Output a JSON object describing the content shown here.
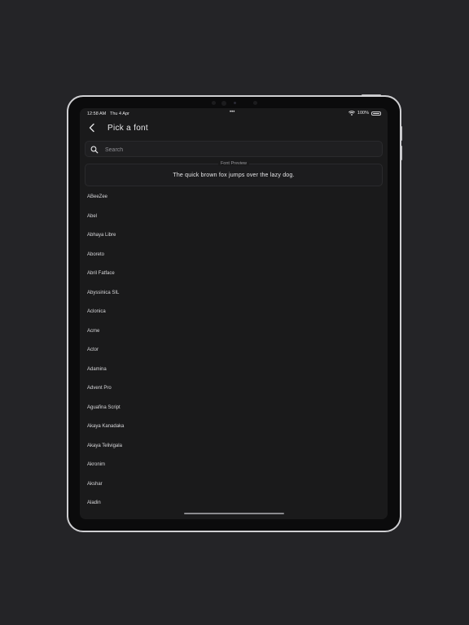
{
  "status_bar": {
    "time": "12:58 AM",
    "date": "Thu 4 Apr",
    "center_dots": "•••",
    "battery": "100%"
  },
  "nav": {
    "back_icon": "chevron-left-icon",
    "title": "Pick a font"
  },
  "search": {
    "icon": "search-icon",
    "placeholder": "Search",
    "value": ""
  },
  "preview": {
    "label": "Font Preview",
    "text": "The quick brown fox jumps over the lazy dog."
  },
  "fonts": [
    "ABeeZee",
    "Abel",
    "Abhaya Libre",
    "Aboreto",
    "Abril Fatface",
    "Abyssinica SIL",
    "Aclonica",
    "Acme",
    "Actor",
    "Adamina",
    "Advent Pro",
    "Aguafina Script",
    "Akaya Kanadaka",
    "Akaya Telivigala",
    "Akronim",
    "Akshar",
    "Aladin"
  ],
  "colors": {
    "background": "#242427",
    "screen": "#1a1a1b",
    "text": "#e6e6e8",
    "bezel": "#cfcfd2"
  }
}
